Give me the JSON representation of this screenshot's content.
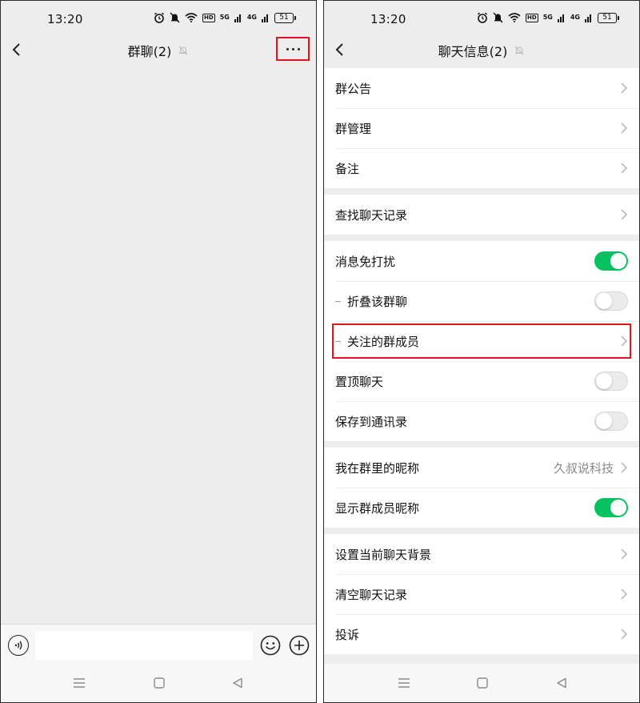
{
  "colors": {
    "accent": "#07c160",
    "highlight": "#e0161b"
  },
  "left": {
    "status": {
      "time": "13:20",
      "battery": "51",
      "net1": "5G",
      "net2": "4G"
    },
    "navbar": {
      "title": "群聊(2)"
    },
    "input": {
      "placeholder": ""
    }
  },
  "right": {
    "status": {
      "time": "13:20",
      "battery": "51",
      "net1": "5G",
      "net2": "4G"
    },
    "navbar": {
      "title": "聊天信息(2)"
    },
    "rows": {
      "announcement": "群公告",
      "manage": "群管理",
      "remark": "备注",
      "search_history": "查找聊天记录",
      "mute": "消息免打扰",
      "fold": "折叠该群聊",
      "follow_members": "关注的群成员",
      "pin": "置顶聊天",
      "save_contacts": "保存到通讯录",
      "my_nickname": "我在群里的昵称",
      "my_nickname_value": "久叔说科技",
      "show_nicknames": "显示群成员昵称",
      "background": "设置当前聊天背景",
      "clear_history": "清空聊天记录",
      "report": "投诉"
    },
    "toggles": {
      "mute": true,
      "fold": false,
      "pin": false,
      "save_contacts": false,
      "show_nicknames": true
    }
  }
}
